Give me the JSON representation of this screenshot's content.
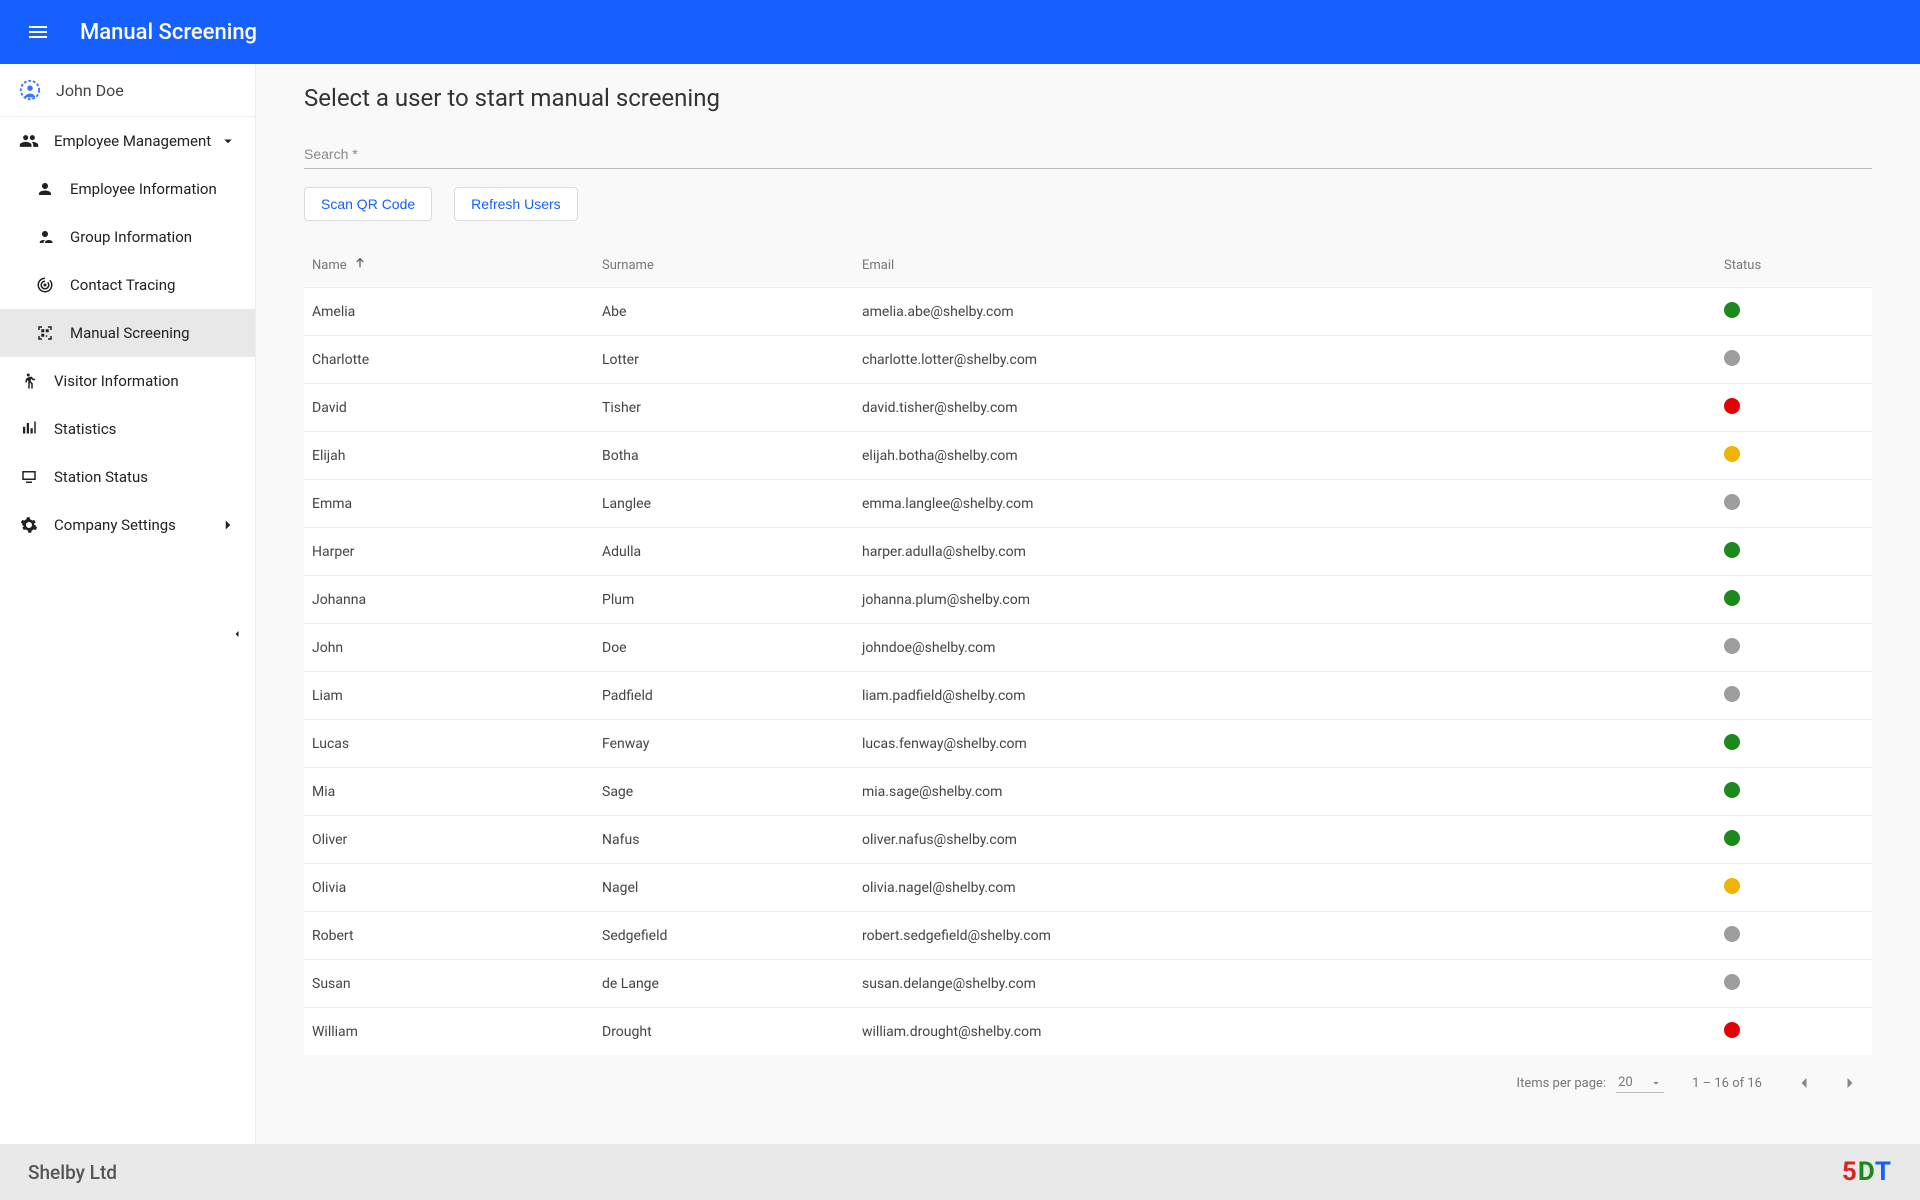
{
  "header": {
    "title": "Manual Screening"
  },
  "user": {
    "name": "John Doe"
  },
  "sidebar": {
    "employee_mgmt": "Employee Management",
    "employee_info": "Employee Information",
    "group_info": "Group Information",
    "contact_tracing": "Contact Tracing",
    "manual_screening": "Manual Screening",
    "visitor_info": "Visitor Information",
    "statistics": "Statistics",
    "station_status": "Station Status",
    "company_settings": "Company Settings"
  },
  "main": {
    "title": "Select a user to start manual screening",
    "search_placeholder": "Search *",
    "scan_btn": "Scan QR Code",
    "refresh_btn": "Refresh Users",
    "columns": {
      "name": "Name",
      "surname": "Surname",
      "email": "Email",
      "status": "Status"
    },
    "status_colors": {
      "green": "#1b8a1b",
      "grey": "#9e9e9e",
      "red": "#e20000",
      "yellow": "#f0b400"
    },
    "rows": [
      {
        "name": "Amelia",
        "surname": "Abe",
        "email": "amelia.abe@shelby.com",
        "status": "green"
      },
      {
        "name": "Charlotte",
        "surname": "Lotter",
        "email": "charlotte.lotter@shelby.com",
        "status": "grey"
      },
      {
        "name": "David",
        "surname": "Tisher",
        "email": "david.tisher@shelby.com",
        "status": "red"
      },
      {
        "name": "Elijah",
        "surname": "Botha",
        "email": "elijah.botha@shelby.com",
        "status": "yellow"
      },
      {
        "name": "Emma",
        "surname": "Langlee",
        "email": "emma.langlee@shelby.com",
        "status": "grey"
      },
      {
        "name": "Harper",
        "surname": "Adulla",
        "email": "harper.adulla@shelby.com",
        "status": "green"
      },
      {
        "name": "Johanna",
        "surname": "Plum",
        "email": "johanna.plum@shelby.com",
        "status": "green"
      },
      {
        "name": "John",
        "surname": "Doe",
        "email": "johndoe@shelby.com",
        "status": "grey"
      },
      {
        "name": "Liam",
        "surname": "Padfield",
        "email": "liam.padfield@shelby.com",
        "status": "grey"
      },
      {
        "name": "Lucas",
        "surname": "Fenway",
        "email": "lucas.fenway@shelby.com",
        "status": "green"
      },
      {
        "name": "Mia",
        "surname": "Sage",
        "email": "mia.sage@shelby.com",
        "status": "green"
      },
      {
        "name": "Oliver",
        "surname": "Nafus",
        "email": "oliver.nafus@shelby.com",
        "status": "green"
      },
      {
        "name": "Olivia",
        "surname": "Nagel",
        "email": "olivia.nagel@shelby.com",
        "status": "yellow"
      },
      {
        "name": "Robert",
        "surname": "Sedgefield",
        "email": "robert.sedgefield@shelby.com",
        "status": "grey"
      },
      {
        "name": "Susan",
        "surname": "de Lange",
        "email": "susan.delange@shelby.com",
        "status": "grey"
      },
      {
        "name": "William",
        "surname": "Drought",
        "email": "william.drought@shelby.com",
        "status": "red"
      }
    ],
    "paginator": {
      "items_per_page_label": "Items per page:",
      "page_size": "20",
      "range": "1 – 16 of 16"
    }
  },
  "footer": {
    "company": "Shelby Ltd",
    "logo": "5DT"
  }
}
